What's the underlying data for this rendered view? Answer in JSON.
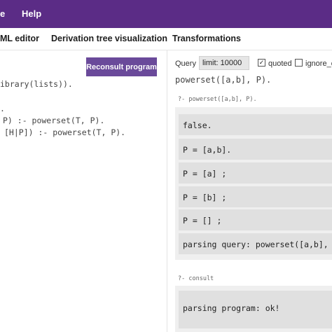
{
  "menu": {
    "item_e": "e",
    "help": "Help"
  },
  "tabs": {
    "html_editor": "ML editor",
    "derivation_tree": "Derivation tree visualization",
    "transformations": "Transformations"
  },
  "editor": {
    "reconsult_button": "Reconsult program",
    "lines": [
      "ibrary(lists)).",
      ".",
      "P) :- powerset(T, P).",
      "[H|P]) :- powerset(T, P)."
    ]
  },
  "query_panel": {
    "query_label": "Query",
    "limit_value": "limit: 10000",
    "quoted_label": "quoted",
    "quoted_checked": true,
    "ignore_label": "ignore_o",
    "ignore_checked": false,
    "query_text": "powerset([a,b], P).",
    "history_label": "?- powerset([a,b], P).",
    "answers": [
      "false.",
      "P = [a,b].",
      "P = [a] ;",
      "P = [b] ;",
      "P = [] ;",
      "parsing query: powerset([a,b],"
    ],
    "consult_label": "?- consult",
    "consult_answer": "parsing program: ok!"
  },
  "colors": {
    "topbar": "#5b2c86",
    "button": "#6a4a9a",
    "answer_bg": "#e0e0e0",
    "panel_bg": "#efefef"
  }
}
